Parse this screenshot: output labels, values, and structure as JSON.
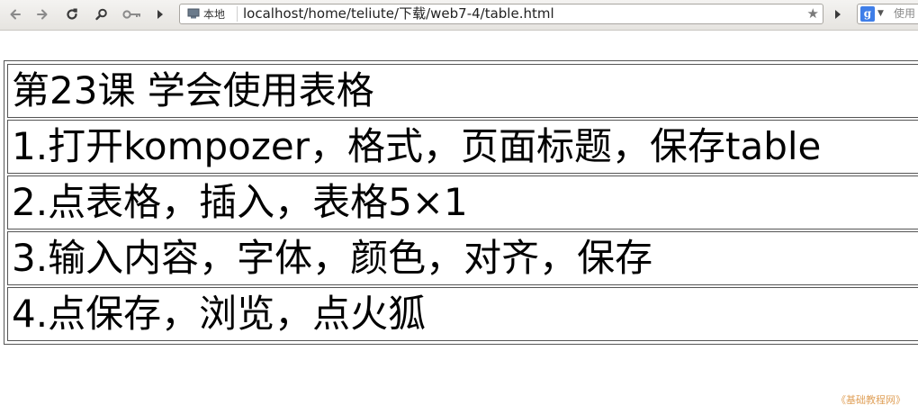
{
  "browser": {
    "identity_label": "本地",
    "url": "localhost/home/teliute/下载/web7-4/table.html",
    "search_engine_letter": "g",
    "search_placeholder": "使用"
  },
  "icons": {
    "back": "back-arrow-icon",
    "forward": "forward-arrow-icon",
    "reload": "reload-icon",
    "search": "magnifier-icon",
    "key": "key-icon",
    "more": "chevron-right-icon",
    "page": "page-icon",
    "bookmark": "star-icon",
    "engine": "google-icon",
    "dropdown": "dropdown-arrow-icon"
  },
  "table": {
    "rows": [
      {
        "text": "第23课  学会使用表格"
      },
      {
        "text": "1.打开kompozer，格式，页面标题，保存table"
      },
      {
        "text": "2.点表格，插入，表格5×1"
      },
      {
        "text": "3.输入内容，字体，颜色，对齐，保存"
      },
      {
        "text": "4.点保存，浏览，点火狐"
      }
    ]
  },
  "watermark": "《基础教程网》",
  "colors": {
    "toolbar_bg": "#eceae6",
    "table_border": "#555555",
    "watermark": "#e0a15a",
    "search_engine": "#3f7ee8"
  }
}
